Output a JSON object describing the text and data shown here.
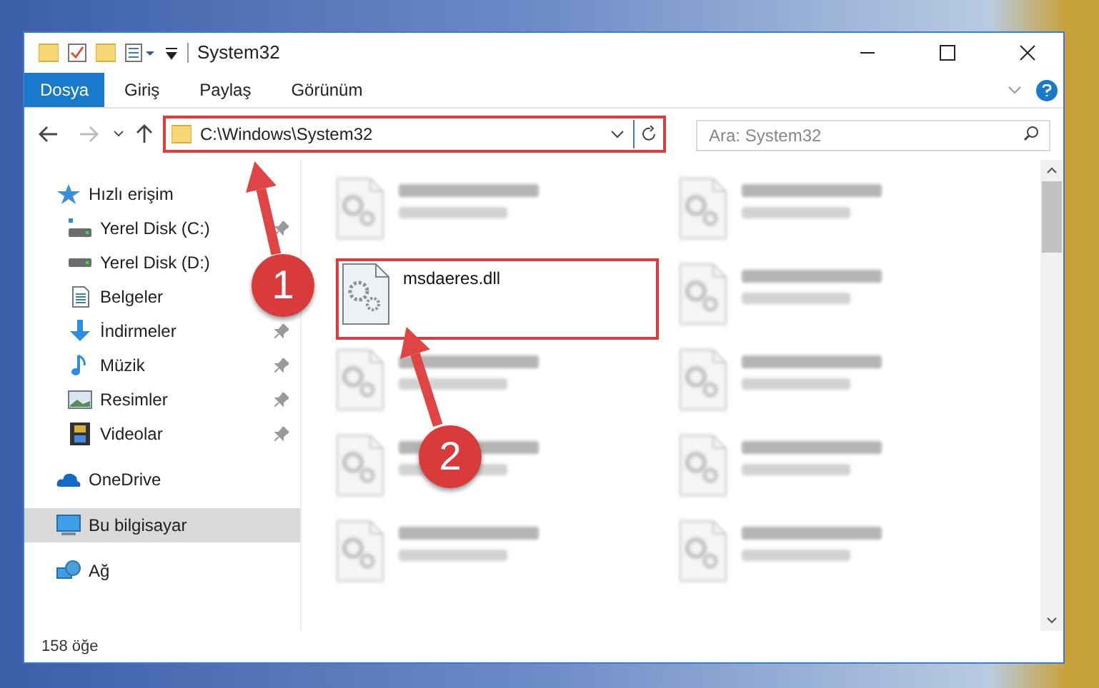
{
  "window": {
    "title": "System32"
  },
  "ribbon_tabs": [
    {
      "label": "Dosya",
      "selected": true
    },
    {
      "label": "Giriş",
      "selected": false
    },
    {
      "label": "Paylaş",
      "selected": false
    },
    {
      "label": "Görünüm",
      "selected": false
    }
  ],
  "address": {
    "path": "C:\\Windows\\System32"
  },
  "search": {
    "placeholder": "Ara: System32"
  },
  "sidebar": {
    "items": [
      {
        "label": "Hızlı erişim",
        "kind": "star",
        "selected": false,
        "children": [
          {
            "label": "Yerel Disk (C:)",
            "kind": "drive-c",
            "selected": false,
            "pinned": true
          },
          {
            "label": "Yerel Disk (D:)",
            "kind": "drive",
            "selected": false,
            "pinned": false
          },
          {
            "label": "Belgeler",
            "kind": "docs",
            "selected": false,
            "pinned": false
          },
          {
            "label": "İndirmeler",
            "kind": "download",
            "selected": false,
            "pinned": true
          },
          {
            "label": "Müzik",
            "kind": "music",
            "selected": false,
            "pinned": true
          },
          {
            "label": "Resimler",
            "kind": "pictures",
            "selected": false,
            "pinned": true
          },
          {
            "label": "Videolar",
            "kind": "video",
            "selected": false,
            "pinned": true
          }
        ]
      },
      {
        "label": "OneDrive",
        "kind": "cloud",
        "selected": false
      },
      {
        "label": "Bu bilgisayar",
        "kind": "pc",
        "selected": true
      },
      {
        "label": "Ağ",
        "kind": "network",
        "selected": false
      }
    ]
  },
  "files": [
    {
      "kind": "blurred"
    },
    {
      "kind": "blurred"
    },
    {
      "kind": "file",
      "name": "msdaeres.dll",
      "highlighted": true
    },
    {
      "kind": "blurred"
    },
    {
      "kind": "blurred"
    },
    {
      "kind": "blurred"
    },
    {
      "kind": "blurred"
    },
    {
      "kind": "blurred"
    },
    {
      "kind": "blurred"
    },
    {
      "kind": "blurred"
    }
  ],
  "status_bar": {
    "count": "158 öğe"
  },
  "annotations": [
    {
      "label": "1"
    },
    {
      "label": "2"
    }
  ]
}
